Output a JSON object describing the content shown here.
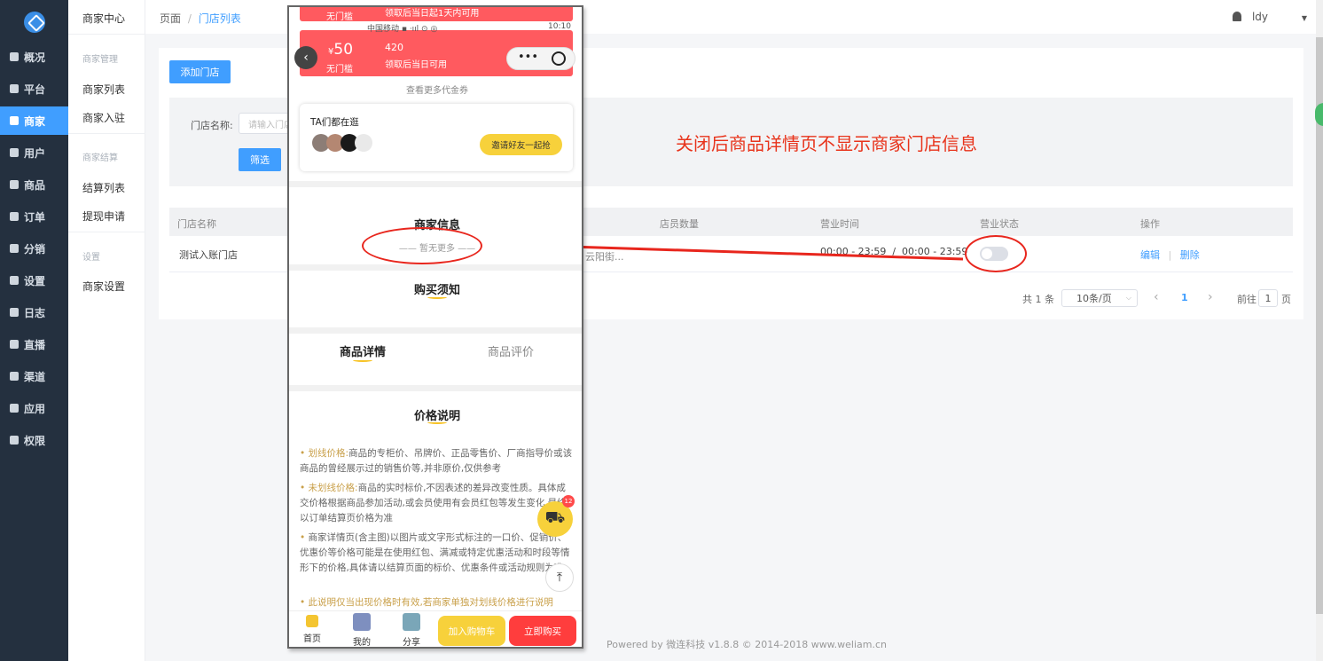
{
  "sidebar": {
    "items": [
      {
        "label": "概况",
        "icon": "dashboard-icon"
      },
      {
        "label": "平台",
        "icon": "monitor-icon"
      },
      {
        "label": "商家",
        "icon": "shop-icon"
      },
      {
        "label": "用户",
        "icon": "user-icon"
      },
      {
        "label": "商品",
        "icon": "goods-icon"
      },
      {
        "label": "订单",
        "icon": "order-icon"
      },
      {
        "label": "分销",
        "icon": "distribution-icon"
      },
      {
        "label": "设置",
        "icon": "gear-icon"
      },
      {
        "label": "日志",
        "icon": "log-icon"
      },
      {
        "label": "直播",
        "icon": "live-icon"
      },
      {
        "label": "渠道",
        "icon": "channel-icon"
      },
      {
        "label": "应用",
        "icon": "apps-icon"
      },
      {
        "label": "权限",
        "icon": "lock-icon"
      }
    ],
    "active": "商家"
  },
  "subnav": {
    "title": "商家中心",
    "group1": "商家管理",
    "merchant_list": "商家列表",
    "merchant_join": "商家入驻",
    "group2": "商家结算",
    "settle_list": "结算列表",
    "withdraw": "提现申请",
    "group3": "设置",
    "merchant_settings": "商家设置"
  },
  "header": {
    "crumb_root": "页面",
    "crumb_sep": "/",
    "crumb_current": "门店列表",
    "user": "ldy"
  },
  "toolbar": {
    "add_store": "添加门店"
  },
  "filter": {
    "label": "门店名称:",
    "placeholder": "请输入门店",
    "submit": "筛选"
  },
  "table": {
    "columns": [
      "门店名称",
      "店员数量",
      "营业时间",
      "营业状态",
      "操作"
    ],
    "rows": [
      {
        "name": "测试入账门店",
        "address_tail": "云阳街...",
        "hours": "00:00 - 23:59  /  00:00 - 23:59",
        "edit": "编辑",
        "sep": "|",
        "delete": "删除",
        "status_on": false
      }
    ]
  },
  "pagination": {
    "total": "共 1 条",
    "page_size": "10条/页",
    "prev": "‹",
    "current": "1",
    "next": "›",
    "goto_label": "前往",
    "goto_value": "1",
    "page_unit": "页"
  },
  "annotation": "关闭后商品详情页不显示商家门店信息",
  "footer": "Powered by 微连科技 v1.8.8 © 2014-2018 www.weliam.cn",
  "phone": {
    "coupon_top": {
      "type": "无门槛",
      "rule": "领取后当日起1天内可用"
    },
    "status_bar": "中国移动 ▪ ‧ııl ⊙ ◎",
    "status_time": "10:10",
    "coupon": {
      "currency": "¥",
      "amount": "50",
      "code": "420",
      "type": "无门槛",
      "rule": "领取后当日可用"
    },
    "more_coupons": "查看更多代金券",
    "friends_title": "TA们都在逛",
    "invite": "邀请好友一起抢",
    "merchant_info_title": "商家信息",
    "no_more": "—— 暂无更多 ——",
    "purchase_notice": "购买须知",
    "tab_details": "商品详情",
    "tab_reviews": "商品评价",
    "price_title": "价格说明",
    "desc": [
      {
        "hl": "划线价格:",
        "text": "商品的专柜价、吊牌价、正品零售价、厂商指导价或该商品的曾经展示过的销售价等,并非原价,仅供参考"
      },
      {
        "hl": "未划线价格:",
        "text": "商品的实时标价,不因表述的差异改变性质。具体成交价格根据商品参加活动,或会员使用有会员红包等发生变化,最终以订单结算页价格为准"
      },
      {
        "hl": "",
        "text": "商家详情页(含主图)以图片或文字形式标注的一口价、促销价、优惠价等价格可能是在使用红包、满减或特定优惠活动和时段等情形下的价格,具体请以结算页面的标价、优惠条件或活动规则为准"
      },
      {
        "hl": "此说明仅当出现价格时有效,若商家单独对划线价格进行说明",
        "text": ""
      }
    ],
    "cart_badge": "12",
    "bottom": {
      "home": "首页",
      "mine": "我的",
      "share": "分享",
      "add_cart": "加入购物车",
      "buy_now": "立即购买"
    }
  }
}
